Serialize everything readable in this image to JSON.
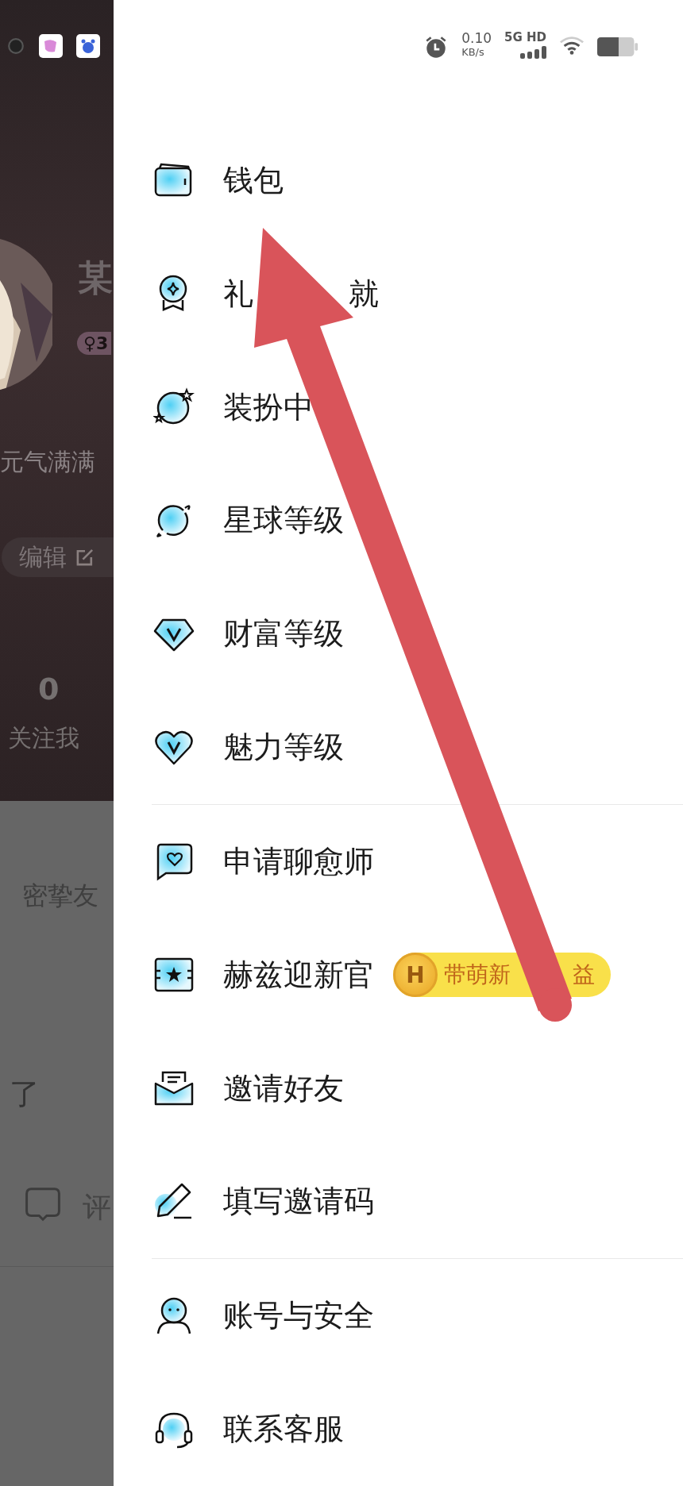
{
  "status_bar": {
    "speed": "0.10",
    "speed_unit": "KB/s",
    "network": "5G HD"
  },
  "profile": {
    "name": "某",
    "badge": "♀3",
    "bio": "元气满满",
    "edit_button": "编辑",
    "stat_value": "0",
    "stat_label": "关注我"
  },
  "feed": {
    "heading": "密挚友",
    "post_text": "了",
    "comment": "评"
  },
  "menu": {
    "sections": [
      {
        "items": [
          {
            "label": "钱包"
          },
          {
            "label": "礼",
            "label_end": "就"
          },
          {
            "label": "装扮中"
          },
          {
            "label": "星球等级"
          },
          {
            "label": "财富等级"
          },
          {
            "label": "魅力等级"
          }
        ]
      },
      {
        "items": [
          {
            "label": "申请聊愈师"
          },
          {
            "label": "赫兹迎新官",
            "badge": {
              "coin": "H",
              "text": "带萌新",
              "text_end": "益"
            }
          },
          {
            "label": "邀请好友"
          },
          {
            "label": "填写邀请码"
          }
        ]
      },
      {
        "items": [
          {
            "label": "账号与安全"
          },
          {
            "label": "联系客服"
          }
        ]
      }
    ]
  }
}
